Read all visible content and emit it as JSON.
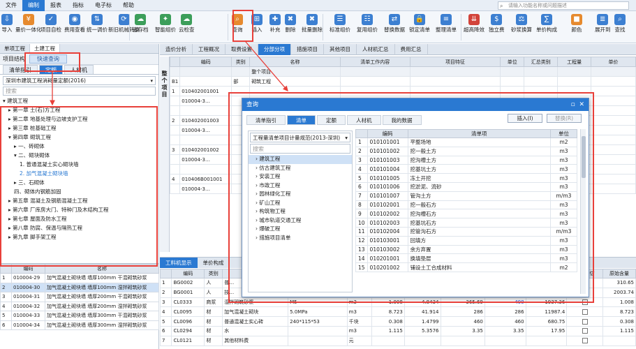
{
  "menu": {
    "items": [
      "文件",
      "编制",
      "报表",
      "指标",
      "电子标",
      "帮助"
    ],
    "search_placeholder": "请输入功能名称或问题描述"
  },
  "ribbon": [
    {
      "label": "导入",
      "icon": "import-icon",
      "color": "#3c7fd1"
    },
    {
      "label": "量价一体化",
      "icon": "price-icon",
      "color": "#e68a2e"
    },
    {
      "label": "项目自检",
      "icon": "check-icon",
      "color": "#3c7fd1"
    },
    {
      "label": "费用查看",
      "icon": "view-icon",
      "color": "#3c7fd1"
    },
    {
      "label": "统一调价",
      "icon": "adjust-icon",
      "color": "#3c7fd1"
    },
    {
      "label": "新旧机械转换",
      "icon": "convert-icon",
      "color": "#3c7fd1"
    },
    {
      "label": "云存档",
      "icon": "cloud-save-icon",
      "color": "#3c9e5a"
    },
    {
      "label": "智能组价",
      "icon": "smart-icon",
      "color": "#3c9e5a"
    },
    {
      "label": "云检查",
      "icon": "cloud-check-icon",
      "color": "#3c9e5a"
    },
    {
      "label": "查询",
      "icon": "query-icon",
      "color": "#e68a2e"
    },
    {
      "label": "插入",
      "icon": "insert-icon",
      "color": "#3c7fd1"
    },
    {
      "label": "补充",
      "icon": "supplement-icon",
      "color": "#3c7fd1"
    },
    {
      "label": "删除",
      "icon": "delete-icon",
      "color": "#3c7fd1"
    },
    {
      "label": "批量删除",
      "icon": "batch-delete-icon",
      "color": "#3c7fd1"
    },
    {
      "label": "标准组价",
      "icon": "standard-icon",
      "color": "#3c7fd1"
    },
    {
      "label": "复用组价",
      "icon": "reuse-icon",
      "color": "#3c7fd1"
    },
    {
      "label": "替换数据",
      "icon": "replace-icon",
      "color": "#3c7fd1"
    },
    {
      "label": "锁定清单",
      "icon": "lock-icon",
      "color": "#3c7fd1"
    },
    {
      "label": "整理清单",
      "icon": "organize-icon",
      "color": "#3c7fd1"
    },
    {
      "label": "超高降效",
      "icon": "efficiency-icon",
      "color": "#d2433a"
    },
    {
      "label": "独立费",
      "icon": "fee-icon",
      "color": "#3c7fd1"
    },
    {
      "label": "砂浆换算",
      "icon": "mortar-icon",
      "color": "#3c7fd1"
    },
    {
      "label": "单价构成",
      "icon": "unit-price-icon",
      "color": "#3c7fd1"
    },
    {
      "label": "颜色",
      "icon": "color-icon",
      "color": "#e68a2e"
    },
    {
      "label": "展开到",
      "icon": "expand-icon",
      "color": "#3c7fd1"
    },
    {
      "label": "查找",
      "icon": "find-icon",
      "color": "#3c7fd1"
    }
  ],
  "left": {
    "tabs": [
      "单项工程",
      "土建工程"
    ],
    "sub_tab": "项目结构",
    "quick_query": "快速查询",
    "lib_tabs": [
      "清单指引",
      "定额",
      "人材机"
    ],
    "lib_select": "深圳市建筑工程消耗量定额(2016)",
    "search_placeholder": "搜索",
    "tree": [
      {
        "text": "▾ 建筑工程",
        "indent": 0,
        "sel": false
      },
      {
        "text": "▸ 第一章  土(石)方工程",
        "indent": 1,
        "sel": false
      },
      {
        "text": "▸ 第二章  地基处理与边坡支护工程",
        "indent": 1,
        "sel": false
      },
      {
        "text": "▸ 第三章  桩基础工程",
        "indent": 1,
        "sel": false
      },
      {
        "text": "▾ 第四章  砌筑工程",
        "indent": 1,
        "sel": false
      },
      {
        "text": "▸ 一、砖砌体",
        "indent": 2,
        "sel": false
      },
      {
        "text": "▾ 二、砌块砌体",
        "indent": 2,
        "sel": false
      },
      {
        "text": "1. 普通混凝土实心砌块墙",
        "indent": 3,
        "sel": false
      },
      {
        "text": "2. 加气混凝土砌块墙",
        "indent": 3,
        "sel": true
      },
      {
        "text": "▸ 三、石砌体",
        "indent": 2,
        "sel": false
      },
      {
        "text": "四、砌体内钢筋加固",
        "indent": 2,
        "sel": false
      },
      {
        "text": "▸ 第五章  混凝土及钢筋混凝土工程",
        "indent": 1,
        "sel": false
      },
      {
        "text": "▸ 第六章  厂库房大门、特种门及木结构工程",
        "indent": 1,
        "sel": false
      },
      {
        "text": "▸ 第七章  屋面及防水工程",
        "indent": 1,
        "sel": false
      },
      {
        "text": "▸ 第八章  防腐、保温与隔热工程",
        "indent": 1,
        "sel": false
      },
      {
        "text": "▸ 第九章  脚手架工程",
        "indent": 1,
        "sel": false
      }
    ],
    "grid_headers": [
      "编码",
      "名称"
    ],
    "grid_rows": [
      [
        "1",
        "010004-29",
        "加气混凝土砌块墙 墙厚100mm 干混砌筑砂浆"
      ],
      [
        "2",
        "010004-30",
        "加气混凝土砌块墙 墙厚100mm 湿拌砌筑砂浆"
      ],
      [
        "3",
        "010004-31",
        "加气混凝土砌块墙 墙厚200mm 干混砌筑砂浆"
      ],
      [
        "4",
        "010004-32",
        "加气混凝土砌块墙 墙厚200mm 湿拌砌筑砂浆"
      ],
      [
        "5",
        "010004-33",
        "加气混凝土砌块墙 墙厚300mm 干混砌筑砂浆"
      ],
      [
        "6",
        "010004-34",
        "加气混凝土砌块墙 墙厚300mm 湿拌砌筑砂浆"
      ]
    ]
  },
  "main": {
    "tabs": [
      "造价分析",
      "工程概况",
      "取费设置",
      "分部分项",
      "措施项目",
      "其他项目",
      "人材机汇总",
      "费用汇总"
    ],
    "side_label": "整个项目",
    "headers": [
      "编码",
      "类别",
      "名称",
      "清单工作内容",
      "项目特征",
      "单位",
      "汇总类别",
      "工程量",
      "单价"
    ],
    "rows": [
      [
        "",
        "",
        "",
        "整个项目",
        "",
        "",
        "",
        "",
        ""
      ],
      [
        "B1",
        "",
        "部",
        "砌筑工程",
        "",
        "",
        "",
        "",
        ""
      ],
      [
        "1",
        "010402001001",
        "",
        "",
        "",
        "",
        "",
        "",
        ""
      ],
      [
        "",
        "010004-3…",
        "",
        "",
        "",
        "",
        "",
        "",
        "6736.07"
      ],
      [
        "",
        "",
        "",
        "",
        "",
        "",
        "",
        "",
        ""
      ],
      [
        "2",
        "010402001003",
        "",
        "",
        "",
        "",
        "",
        "",
        ""
      ],
      [
        "",
        "010004-3…",
        "",
        "",
        "",
        "",
        "",
        "",
        "6736.07"
      ],
      [
        "",
        "",
        "",
        "",
        "",
        "",
        "",
        "",
        ""
      ],
      [
        "3",
        "010402001002",
        "",
        "",
        "",
        "",
        "",
        "",
        ""
      ],
      [
        "",
        "010004-3…",
        "",
        "",
        "",
        "",
        "",
        "",
        "6242.3"
      ],
      [
        "",
        "",
        "",
        "",
        "",
        "",
        "",
        "",
        ""
      ],
      [
        "4",
        "010406B001001",
        "",
        "",
        "",
        "",
        "",
        "",
        ""
      ],
      [
        "",
        "010004-3…",
        "",
        "",
        "",
        "",
        "",
        "",
        ""
      ]
    ],
    "bottom_tabs": [
      "工料机显示",
      "单价构成"
    ],
    "bottom_rows": [
      [
        "1",
        "BG0002",
        "人",
        "普…",
        "",
        "",
        "",
        "",
        "",
        "",
        "",
        "",
        "310.65"
      ],
      [
        "2",
        "BG0001",
        "人",
        "技…",
        "",
        "",
        "",
        "",
        "",
        "",
        "",
        "",
        "2003.74"
      ],
      [
        "3",
        "CL0333",
        "商浆",
        "湿拌砌筑砂浆",
        "M5",
        "m3",
        "1.008",
        "4.8434",
        "365.69",
        "400",
        "1937.36",
        "",
        "1.008"
      ],
      [
        "4",
        "CL0095",
        "材",
        "加气混凝土砌块",
        "5.0MPa",
        "m3",
        "8.723",
        "41.914",
        "286",
        "286",
        "11987.4",
        "",
        "8.723"
      ],
      [
        "5",
        "CL0096",
        "材",
        "普通混凝土实心砖",
        "240*115*53",
        "千块",
        "0.308",
        "1.4799",
        "460",
        "460",
        "680.75",
        "",
        "0.308"
      ],
      [
        "6",
        "CL0294",
        "材",
        "水",
        "",
        "m3",
        "1.115",
        "5.3576",
        "3.35",
        "3.35",
        "17.95",
        "",
        "1.115"
      ],
      [
        "7",
        "CL0121",
        "材",
        "其他材料费",
        "",
        "元",
        "",
        "",
        "",
        "",
        "",
        "",
        ""
      ]
    ],
    "bottom_headers": [
      "",
      "编码",
      "类别",
      "名称",
      "规格及型号",
      "单位",
      "损耗率",
      "含量",
      "不含税市场价",
      "含税市场价",
      "合价",
      "是否暂估",
      "原始含量"
    ]
  },
  "dialog": {
    "title": "查询",
    "tabs": [
      "清单指引",
      "清单",
      "定额",
      "人材机",
      "我的数据"
    ],
    "insert_label": "插入(I)",
    "replace_label": "替换(R)",
    "select": "工程量清单项目计量规范(2013-深圳)",
    "search_placeholder": "搜索",
    "tree": [
      "建筑工程",
      "仿古建筑工程",
      "安装工程",
      "市政工程",
      "园林绿化工程",
      "矿山工程",
      "构筑物工程",
      "城市轨道交通工程",
      "爆破工程",
      "措施项目清单"
    ],
    "headers": [
      "编码",
      "清单项",
      "单位"
    ],
    "rows": [
      [
        "1",
        "010101001",
        "平整场地",
        "m2"
      ],
      [
        "2",
        "010101002",
        "挖一般土方",
        "m3"
      ],
      [
        "3",
        "010101003",
        "挖沟槽土方",
        "m3"
      ],
      [
        "4",
        "010101004",
        "挖基坑土方",
        "m3"
      ],
      [
        "5",
        "010101005",
        "冻土开挖",
        "m3"
      ],
      [
        "6",
        "010101006",
        "挖淤泥、流砂",
        "m3"
      ],
      [
        "7",
        "010101007",
        "管沟土方",
        "m/m3"
      ],
      [
        "8",
        "010102001",
        "挖一般石方",
        "m3"
      ],
      [
        "9",
        "010102002",
        "挖沟槽石方",
        "m3"
      ],
      [
        "10",
        "010102003",
        "挖基坑石方",
        "m3"
      ],
      [
        "11",
        "010102004",
        "挖管沟石方",
        "m/m3"
      ],
      [
        "12",
        "010103001",
        "回填方",
        "m3"
      ],
      [
        "13",
        "010103002",
        "余方弃置",
        "m3"
      ],
      [
        "14",
        "010201001",
        "换填垫层",
        "m3"
      ],
      [
        "15",
        "010201002",
        "铺设土工合成材料",
        "m2"
      ]
    ]
  },
  "colors": {
    "accent": "#2a79d2",
    "highlight": "#e8403a"
  }
}
